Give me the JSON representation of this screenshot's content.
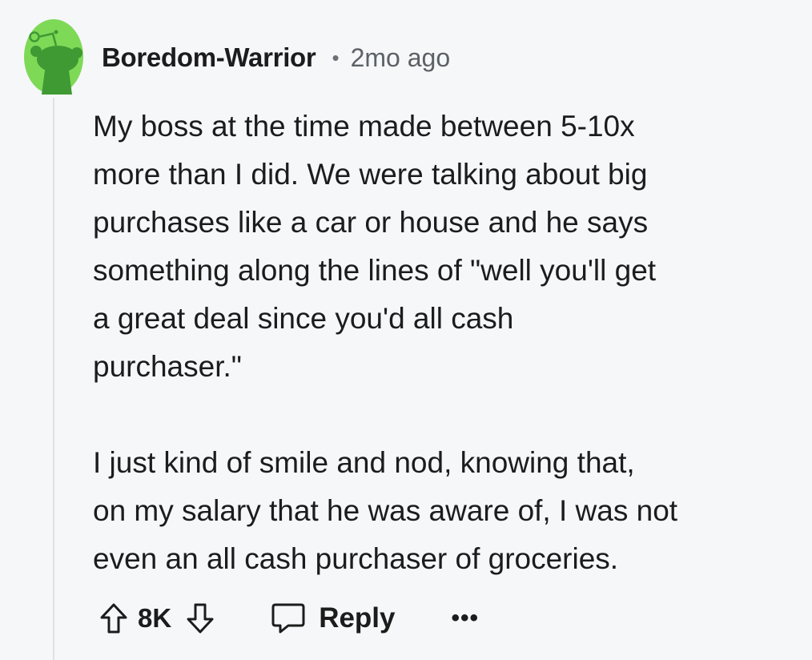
{
  "comment": {
    "username": "Boredom-Warrior",
    "separator": "•",
    "timestamp": "2mo ago",
    "paragraphs": [
      "My boss at the time made between 5-10x\nmore than I did.  We were talking about big\npurchases like a car or house and he says\nsomething along the lines of \"well you'll get\na great deal since you'd all cash\npurchaser.\"",
      "I just kind of smile and nod, knowing that,\non my salary that he was aware of, I was not\neven an all cash purchaser of groceries."
    ]
  },
  "actions": {
    "score": "8K",
    "reply_label": "Reply",
    "more_label": "•••"
  },
  "icons": {
    "avatar": "snoo-avatar-icon",
    "upvote": "upvote-arrow-icon",
    "downvote": "downvote-arrow-icon",
    "reply": "speech-bubble-icon",
    "more": "more-options-icon"
  },
  "colors": {
    "background": "#f6f7f9",
    "avatar_bg": "#7ed957",
    "avatar_figure": "#3f9a33",
    "thread_line": "#dde1e6",
    "text": "#1c1c1c",
    "meta_text": "#5c6166"
  }
}
